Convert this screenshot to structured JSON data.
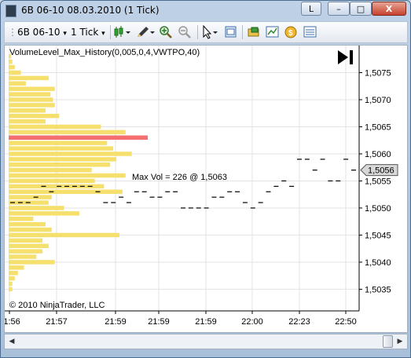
{
  "window": {
    "title": "6B 06-10   08.03.2010 (1 Tick)",
    "caption_buttons": {
      "layout": "L",
      "minimize": "–",
      "maximize": "□",
      "close": "X"
    }
  },
  "toolbar": {
    "instrument": "6B 06-10",
    "interval": "1 Tick",
    "dropdown_glyph": "▾",
    "icons": [
      "candlestick-icon",
      "pencil-icon",
      "zoom-in-icon",
      "zoom-out-icon",
      "cursor-icon",
      "data-box-icon",
      "properties-icon",
      "indicators-icon",
      "strategies-icon",
      "chart-trader-icon"
    ]
  },
  "chart": {
    "indicator_label": "VolumeLevel_Max_History(0,005,0,4,VWTPO,40)",
    "annotation": "Max Vol = 226 @ 1,5063",
    "copyright": "© 2010 NinjaTrader, LLC",
    "last_price": "1,5056",
    "play_icon": "skip-to-end-icon",
    "colors": {
      "volume_bar": "#f5e06e",
      "max_bar": "#f47070",
      "price": "#000000",
      "grid": "#e3e3e3"
    }
  },
  "chart_data": {
    "type": "bar",
    "orientation": "horizontal volume profile + tick price line",
    "y_axis_labels": [
      "1,5075",
      "1,5070",
      "1,5065",
      "1,5060",
      "1,5055",
      "1,5050",
      "1,5045",
      "1,5040",
      "1,5035"
    ],
    "y_ticks": [
      1.5075,
      1.507,
      1.5065,
      1.506,
      1.5055,
      1.505,
      1.5045,
      1.504,
      1.5035
    ],
    "ylim": [
      1.5031,
      1.508
    ],
    "x_axis_labels": [
      "21:56",
      "21:57",
      "21:59",
      "21:59",
      "21:59",
      "22:00",
      "22:23",
      "22:50"
    ],
    "volume_profile": {
      "max_volume": 226,
      "max_price": 1.5063,
      "levels": [
        {
          "price": 1.5078,
          "volume": 4
        },
        {
          "price": 1.5077,
          "volume": 6
        },
        {
          "price": 1.5076,
          "volume": 10
        },
        {
          "price": 1.5075,
          "volume": 20
        },
        {
          "price": 1.5074,
          "volume": 65
        },
        {
          "price": 1.5073,
          "volume": 28
        },
        {
          "price": 1.5072,
          "volume": 75
        },
        {
          "price": 1.5071,
          "volume": 68
        },
        {
          "price": 1.507,
          "volume": 72
        },
        {
          "price": 1.5069,
          "volume": 75
        },
        {
          "price": 1.5068,
          "volume": 60
        },
        {
          "price": 1.5067,
          "volume": 82
        },
        {
          "price": 1.5066,
          "volume": 60
        },
        {
          "price": 1.5065,
          "volume": 150
        },
        {
          "price": 1.5064,
          "volume": 190
        },
        {
          "price": 1.5063,
          "volume": 226
        },
        {
          "price": 1.5062,
          "volume": 160
        },
        {
          "price": 1.5061,
          "volume": 170
        },
        {
          "price": 1.506,
          "volume": 200
        },
        {
          "price": 1.5059,
          "volume": 175
        },
        {
          "price": 1.5058,
          "volume": 165
        },
        {
          "price": 1.5057,
          "volume": 135
        },
        {
          "price": 1.5056,
          "volume": 190
        },
        {
          "price": 1.5055,
          "volume": 140
        },
        {
          "price": 1.5054,
          "volume": 155
        },
        {
          "price": 1.5053,
          "volume": 185
        },
        {
          "price": 1.5052,
          "volume": 70
        },
        {
          "price": 1.5051,
          "volume": 65
        },
        {
          "price": 1.505,
          "volume": 90
        },
        {
          "price": 1.5049,
          "volume": 115
        },
        {
          "price": 1.5048,
          "volume": 40
        },
        {
          "price": 1.5047,
          "volume": 60
        },
        {
          "price": 1.5046,
          "volume": 70
        },
        {
          "price": 1.5045,
          "volume": 180
        },
        {
          "price": 1.5044,
          "volume": 55
        },
        {
          "price": 1.5043,
          "volume": 65
        },
        {
          "price": 1.5042,
          "volume": 55
        },
        {
          "price": 1.5041,
          "volume": 45
        },
        {
          "price": 1.504,
          "volume": 75
        },
        {
          "price": 1.5039,
          "volume": 25
        },
        {
          "price": 1.5038,
          "volume": 15
        },
        {
          "price": 1.5037,
          "volume": 10
        },
        {
          "price": 1.5036,
          "volume": 6
        },
        {
          "price": 1.5035,
          "volume": 6
        }
      ]
    },
    "price_ticks": [
      1.5051,
      1.5051,
      1.5051,
      1.5052,
      1.5054,
      1.5053,
      1.5054,
      1.5054,
      1.5054,
      1.5054,
      1.5054,
      1.5053,
      1.5051,
      1.5051,
      1.5052,
      1.5051,
      1.5053,
      1.5053,
      1.5052,
      1.5052,
      1.5053,
      1.5053,
      1.505,
      1.505,
      1.505,
      1.505,
      1.5052,
      1.5052,
      1.5053,
      1.5053,
      1.5051,
      1.505,
      1.5051,
      1.5053,
      1.5054,
      1.5055,
      1.5054,
      1.5059,
      1.5059,
      1.5057,
      1.5059,
      1.5055,
      1.5055,
      1.5059,
      1.5057
    ]
  }
}
